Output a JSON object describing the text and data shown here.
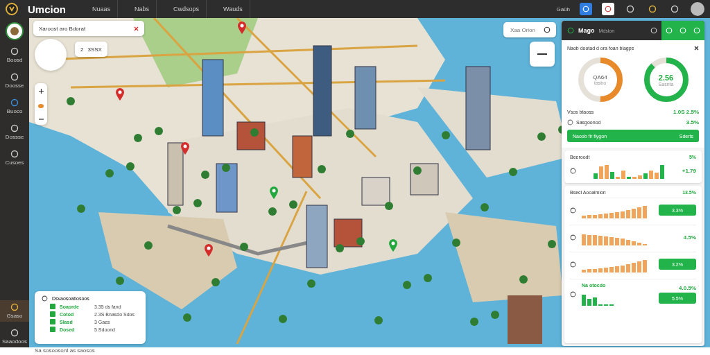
{
  "app": {
    "title": "Umcion"
  },
  "nav": [
    {
      "label": "Nuaas",
      "selected": false
    },
    {
      "label": "Nabs",
      "selected": false
    },
    {
      "label": "Cwdsops",
      "selected": false
    },
    {
      "label": "Wauds",
      "selected": false
    }
  ],
  "topbar": {
    "user_label": "Gaüh"
  },
  "sidebar": {
    "items": [
      {
        "label": "Boosd",
        "selected": false
      },
      {
        "label": "Doosse",
        "selected": false
      },
      {
        "label": "Buoco",
        "selected": false
      },
      {
        "label": "Dossse",
        "selected": false
      },
      {
        "label": "Cusoes",
        "selected": false
      }
    ],
    "bottom_items": [
      {
        "label": "Gsaso",
        "selected": true
      },
      {
        "label": "Saaodoos",
        "selected": false
      }
    ]
  },
  "map": {
    "filter_chip": "Xaroost aro Bdorat",
    "place_bubble": {
      "icon_text": "2",
      "label": "3SSX"
    },
    "search": {
      "placeholder": "Xaa Orion"
    },
    "legend": {
      "title": "Dsvaosoabosoos",
      "items": [
        {
          "name": "Soaorde",
          "value": "3.35 ds fand"
        },
        {
          "name": "Cotod",
          "value": "2.3S Bnasdo Sdos"
        },
        {
          "name": "Slasd",
          "value": "3 Gaes"
        },
        {
          "name": "Dosed",
          "value": "5 Sdoond"
        }
      ]
    }
  },
  "panel": {
    "title": "Mago",
    "subtitle": "Mdsion",
    "heading": "Naob dootad d ora foan blagps",
    "gauges": [
      {
        "value": "QA64",
        "caption": "tasbo",
        "level": 0.5,
        "color": "#e8892a"
      },
      {
        "value": "2.56",
        "caption": "Sasnta",
        "level": 0.88,
        "color": "#22b34a"
      }
    ],
    "stats": [
      {
        "label": "Vsos btaoss",
        "value": "1.0S 2.5%"
      },
      {
        "label": "Sasgoonod",
        "value": "3.5%"
      }
    ],
    "action": {
      "label": "Naoob fir fiygon",
      "hint": "Sderts"
    },
    "trend_card": {
      "title": "Beeroodt",
      "change": "5%",
      "value": "+1.79"
    },
    "list_card": {
      "title": "Bsecl Aooalmion",
      "total": "13.5%",
      "rows": [
        {
          "kind": "button",
          "value": "3.3%"
        },
        {
          "kind": "text",
          "value": "4.5%"
        },
        {
          "kind": "button",
          "value": "3.2%"
        },
        {
          "kind": "button",
          "value": "5.5%",
          "label": "Na otocdo",
          "text": "4.0.5%"
        }
      ]
    }
  },
  "status_bar": "Sa sosoosont as saosos"
}
